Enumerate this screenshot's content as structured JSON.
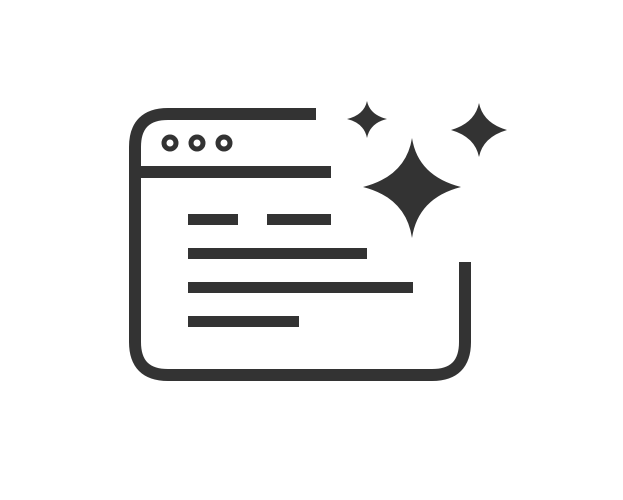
{
  "icon": {
    "name": "browser-window-sparkle-icon",
    "color": "#333333",
    "background": "#ffffff",
    "window_controls": [
      "dot-control-1",
      "dot-control-2",
      "dot-control-3"
    ],
    "text_lines": 5,
    "sparkles": 3
  }
}
